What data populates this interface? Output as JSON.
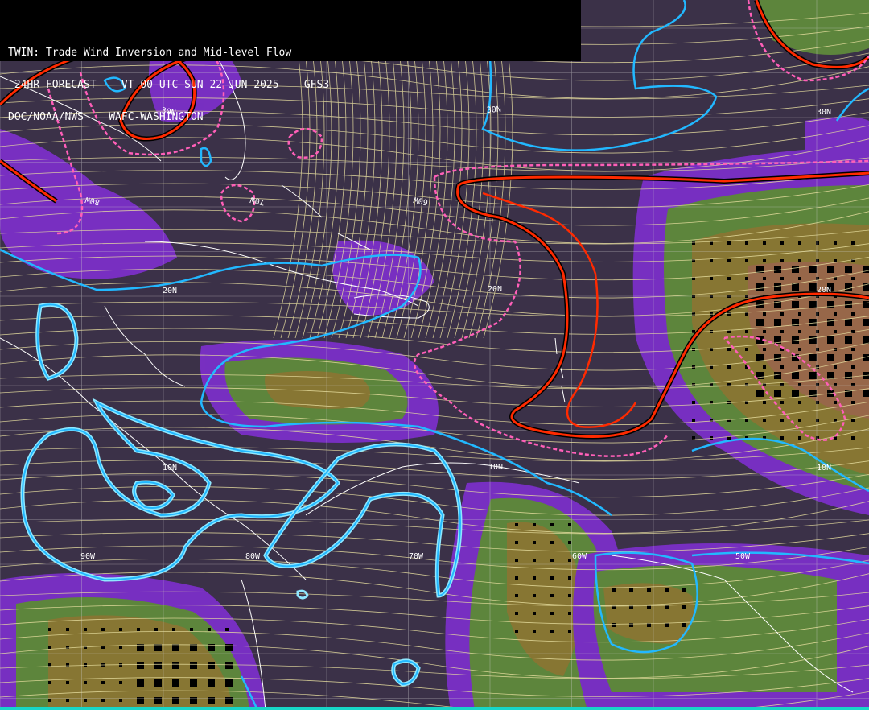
{
  "header": {
    "line1": "TWIN: Trade Wind Inversion and Mid-level Flow",
    "line2": " 24HR FORECAST    VT 00 UTC SUN 22 JUN 2025    GFS3",
    "line3": "DOC/NOAA/NWS    WAFC-WASHINGTON"
  },
  "map": {
    "background_color": "#3b3148",
    "lat_labels": [
      {
        "text": "30N"
      },
      {
        "text": "30N"
      },
      {
        "text": "30N"
      },
      {
        "text": "20N"
      },
      {
        "text": "20N"
      },
      {
        "text": "20N"
      },
      {
        "text": "10N"
      },
      {
        "text": "10N"
      },
      {
        "text": "10N"
      }
    ],
    "lon_labels": [
      {
        "text": "80W"
      },
      {
        "text": "70W"
      },
      {
        "text": "60W"
      },
      {
        "text": "90W"
      },
      {
        "text": "80W"
      },
      {
        "text": "70W"
      },
      {
        "text": "60W"
      },
      {
        "text": "50W"
      }
    ],
    "colors": {
      "inversion_red": "#ff2a00",
      "inversion_pink": "#ff5fb8",
      "isoline_cyan": "#22b8ff",
      "streamline": "#e8dfa0",
      "coast": "#ffffff",
      "shade_purple": "#7b2fc8",
      "shade_blue": "#4a4f9a",
      "shade_green": "#5f8a3c",
      "shade_olive": "#8c7a32",
      "shade_brown": "#9c6a4a"
    }
  }
}
